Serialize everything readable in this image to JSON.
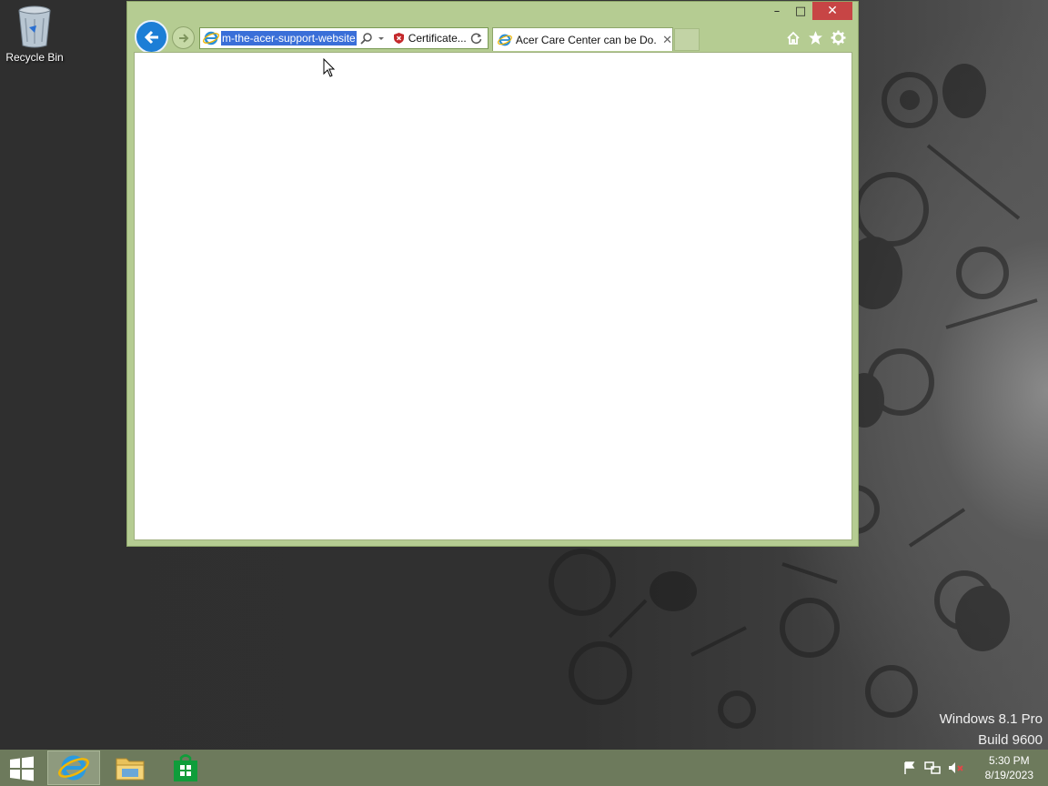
{
  "desktop": {
    "recycle_bin_label": "Recycle Bin",
    "watermark_line1": "Windows 8.1 Pro",
    "watermark_line2": "Build 9600"
  },
  "browser": {
    "accent_color": "#b5cc92",
    "address": {
      "url_visible": "m-the-acer-support-website",
      "certificate_label": "Certificate..."
    },
    "tab": {
      "title": "Acer Care Center can be Do..."
    },
    "window_controls": {
      "minimize": "–",
      "maximize": "□",
      "close": "✕"
    },
    "toolbar_icons": [
      "home-icon",
      "favorites-star-icon",
      "settings-gear-icon"
    ]
  },
  "taskbar": {
    "pinned": [
      "internet-explorer-icon",
      "file-explorer-icon",
      "store-icon"
    ],
    "tray_icons": [
      "action-center-flag-icon",
      "network-icon",
      "volume-muted-icon"
    ],
    "clock_time": "5:30 PM",
    "clock_date": "8/19/2023"
  }
}
